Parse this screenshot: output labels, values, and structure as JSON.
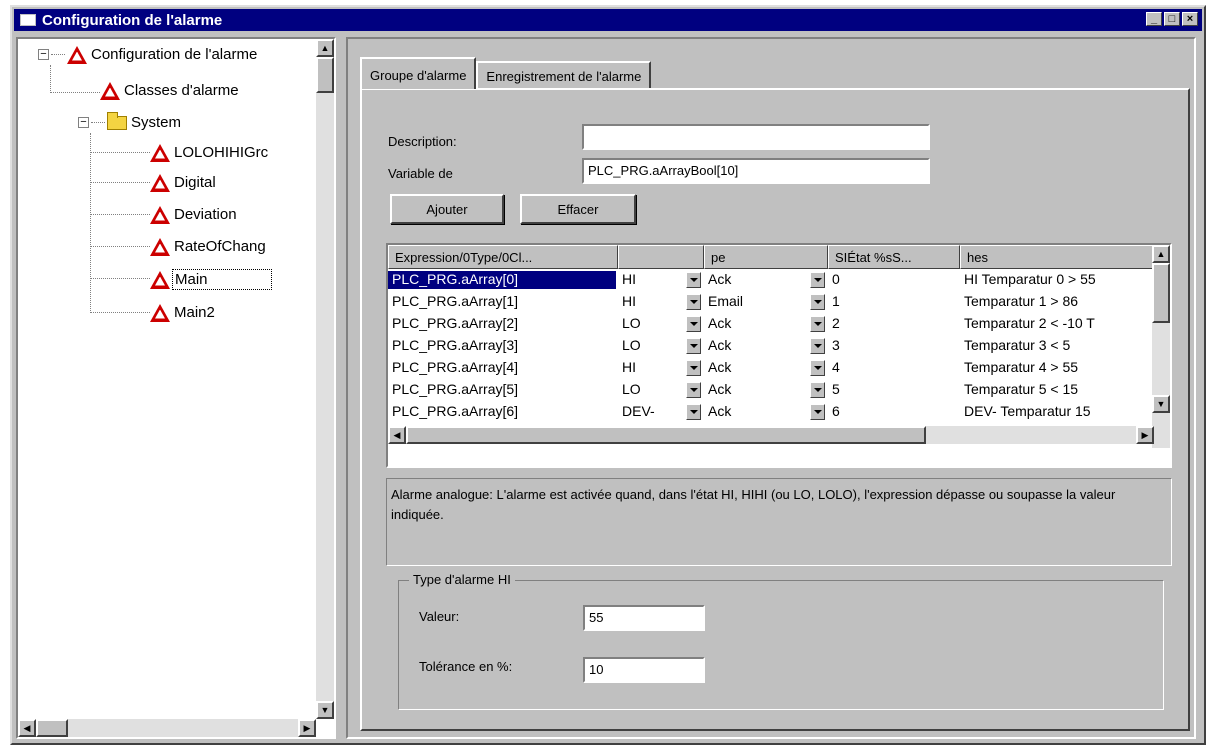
{
  "window": {
    "title": "Configuration de l'alarme"
  },
  "tree": {
    "root": "Configuration de l'alarme",
    "classes": "Classes d'alarme",
    "system": "System",
    "groups": [
      "LOLOHIHIGrc",
      "Digital",
      "Deviation",
      "RateOfChang",
      "Main",
      "Main2"
    ]
  },
  "tabs": [
    "Groupe d'alarme",
    "Enregistrement de l'alarme"
  ],
  "form": {
    "description_label": "Description:",
    "description_value": "",
    "variable_label": "Variable de",
    "variable_value": "PLC_PRG.aArrayBool[10]",
    "add_button": "Ajouter",
    "delete_button": "Effacer"
  },
  "table": {
    "headers": [
      "Expression/0Type/0Cl...",
      "",
      "pe",
      "SIÉtat %sS...",
      "hes"
    ],
    "rows": [
      [
        "PLC_PRG.aArray[0]",
        "HI",
        "Ack",
        "0",
        "HI Temparatur 0 > 55"
      ],
      [
        "PLC_PRG.aArray[1]",
        "HI",
        "Email",
        "1",
        "Temparatur 1 > 86"
      ],
      [
        "PLC_PRG.aArray[2]",
        "LO",
        "Ack",
        "2",
        "Temparatur 2 < -10 T"
      ],
      [
        "PLC_PRG.aArray[3]",
        "LO",
        "Ack",
        "3",
        "Temparatur 3 < 5"
      ],
      [
        "PLC_PRG.aArray[4]",
        "HI",
        "Ack",
        "4",
        "Temparatur 4 > 55"
      ],
      [
        "PLC_PRG.aArray[5]",
        "LO",
        "Ack",
        "5",
        "Temparatur 5 < 15"
      ],
      [
        "PLC_PRG.aArray[6]",
        "DEV-",
        "Ack",
        "6",
        "DEV- Temparatur 15"
      ]
    ]
  },
  "info_text": "Alarme analogue: L'alarme est activée quand, dans l'état HI, HIHI (ou LO, LOLO), l'expression dépasse ou soupasse la valeur indiquée.",
  "alarm_type": {
    "title": "Type d'alarme HI",
    "value_label": "Valeur:",
    "value": "55",
    "tolerance_label": "Tolérance en %:",
    "tolerance": "10"
  },
  "colors": {
    "title_bar": "#000080",
    "selection": "#000080",
    "alarm_icon": "#cc0000"
  }
}
